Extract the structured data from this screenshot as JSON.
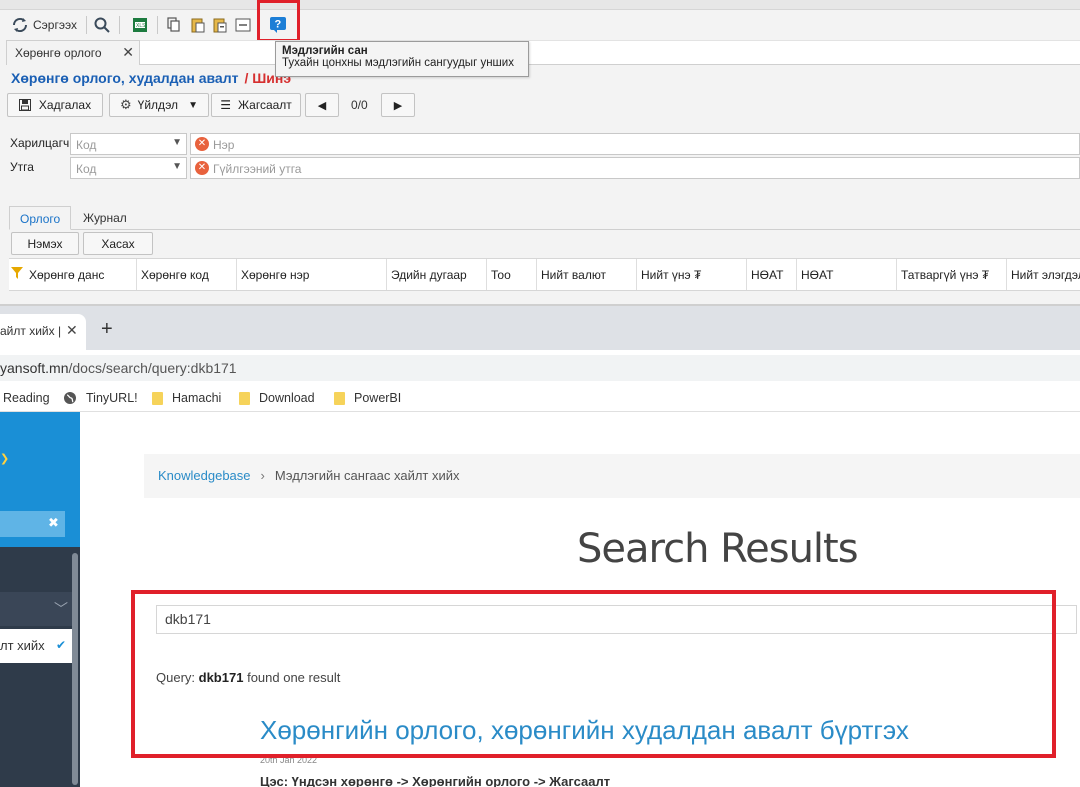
{
  "app": {
    "toolbar": {
      "refresh_label": "Сэргээх",
      "icons": [
        "refresh-icon",
        "search-icon",
        "excel-icon",
        "copy-icon",
        "paste-icon",
        "paste-special-icon",
        "list-icon",
        "help-icon"
      ]
    },
    "tooltip": {
      "title": "Мэдлэгийн сан",
      "text": "Тухайн цонхны мэдлэгийн сангуудыг унших"
    },
    "tab": {
      "label": "Хөрөнгө орлого",
      "close": "✕"
    },
    "page_title": "Хөрөнгө орлого, худалдан авалт",
    "page_subtitle": "/ Шинэ",
    "buttons": {
      "save": "Хадгалах",
      "actions": "Үйлдэл",
      "list": "Жагсаалт",
      "pager": "0/0"
    },
    "form": {
      "partner_label": "Харилцагч",
      "partner_code_placeholder": "Код",
      "partner_name_placeholder": "Нэр",
      "value_label": "Утга",
      "value_code_placeholder": "Код",
      "value_text_placeholder": "Гүйлгээний утга"
    },
    "subtabs": [
      "Орлого",
      "Журнал"
    ],
    "grid_buttons": {
      "add": "Нэмэх",
      "remove": "Хасах"
    },
    "grid_columns": [
      "Хөрөнгө данс",
      "Хөрөнгө код",
      "Хөрөнгө нэр",
      "Эдийн дугаар",
      "Тоо",
      "Нийт валют",
      "Нийт үнэ ₮",
      "НӨАТ",
      "НӨАТ",
      "Татваргүй үнэ ₮",
      "Нийт элэгдэл"
    ]
  },
  "browser": {
    "tab_title": "айлт хийх |",
    "tab_close": "✕",
    "new_tab": "+",
    "address_main": "yansoft.mn",
    "address_path": "/docs/search/query:dkb171",
    "bookmarks": [
      {
        "label": "Reading",
        "icon": "reading-list-icon"
      },
      {
        "label": "TinyURL!",
        "icon": "globe-icon"
      },
      {
        "label": "Hamachi",
        "icon": "folder-icon"
      },
      {
        "label": "Download",
        "icon": "folder-icon"
      },
      {
        "label": "PowerBI",
        "icon": "folder-icon"
      }
    ],
    "sidebar": {
      "search_clear": "✖",
      "active_item": "лт хийх"
    },
    "breadcrumb": {
      "root": "Knowledgebase",
      "separator": "›",
      "current": "Мэдлэгийн сангаас хайлт хийх"
    },
    "results_title": "Search Results",
    "search_value": "dkb171",
    "query": {
      "prefix": "Query:",
      "term": "dkb171",
      "suffix": "found one result"
    },
    "result": {
      "title": "Хөрөнгийн орлого, хөрөнгийн худалдан авалт бүртгэх",
      "date": "20th Jan 2022",
      "path": "Цэс: Үндсэн хөрөнгө -> Хөрөнгийн орлого -> Жагсаалт"
    }
  },
  "colors": {
    "highlight": "#e0202a",
    "link": "#2a8bc7",
    "title_blue": "#1a5fb4",
    "sidebar_blue": "#1a8fd6"
  }
}
